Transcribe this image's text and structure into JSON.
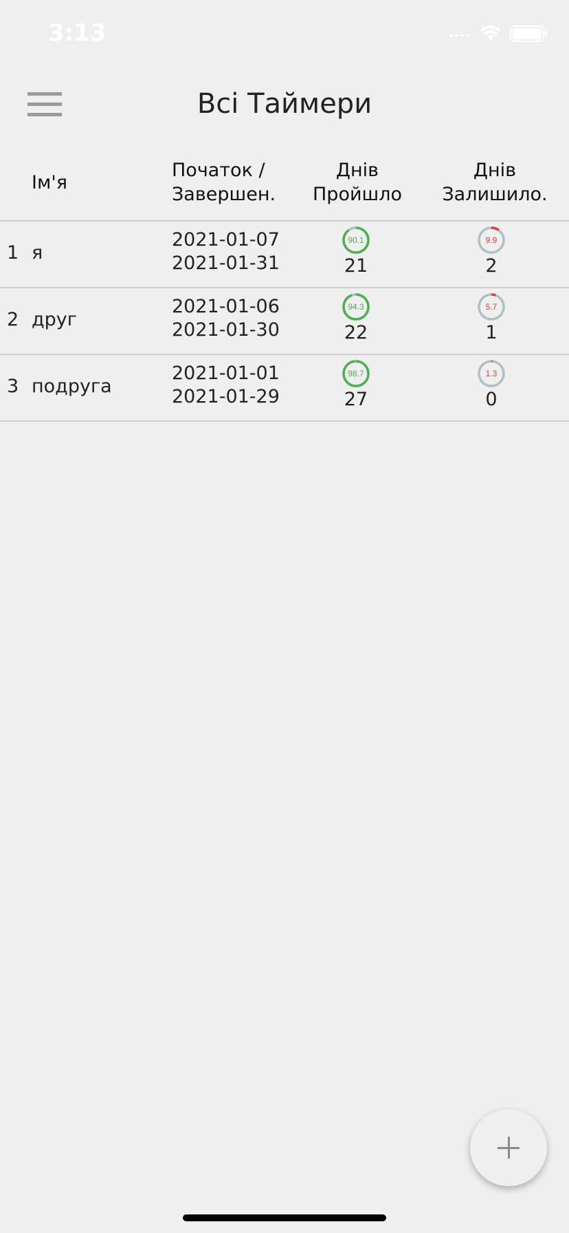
{
  "status_bar": {
    "time": "3:13",
    "icons": [
      "signal-icon",
      "wifi-icon",
      "battery-icon"
    ]
  },
  "header": {
    "title": "Всі Таймери",
    "menu_icon": "hamburger-menu-icon"
  },
  "table": {
    "columns": {
      "name": "Ім'я",
      "dates_line1": "Початок /",
      "dates_line2": "Завершен.",
      "passed_line1": "Днів",
      "passed_line2": "Пройшло",
      "left_line1": "Днів",
      "left_line2": "Залишило."
    },
    "rows": [
      {
        "index": "1",
        "name": "я",
        "start": "2021-01-07",
        "end": "2021-01-31",
        "passed_percent": "90.1",
        "passed_days": "21",
        "left_percent": "9.9",
        "left_days": "2"
      },
      {
        "index": "2",
        "name": "друг",
        "start": "2021-01-06",
        "end": "2021-01-30",
        "passed_percent": "94.3",
        "passed_days": "22",
        "left_percent": "5.7",
        "left_days": "1"
      },
      {
        "index": "3",
        "name": "подруга",
        "start": "2021-01-01",
        "end": "2021-01-29",
        "passed_percent": "98.7",
        "passed_days": "27",
        "left_percent": "1.3",
        "left_days": "0"
      }
    ]
  },
  "fab": {
    "icon": "plus-icon"
  },
  "colors": {
    "background": "#efefef",
    "passed_ring": "#4caf50",
    "left_ring": "#e53935",
    "ring_track": "#b0bec5",
    "divider": "#d0d0d0"
  }
}
